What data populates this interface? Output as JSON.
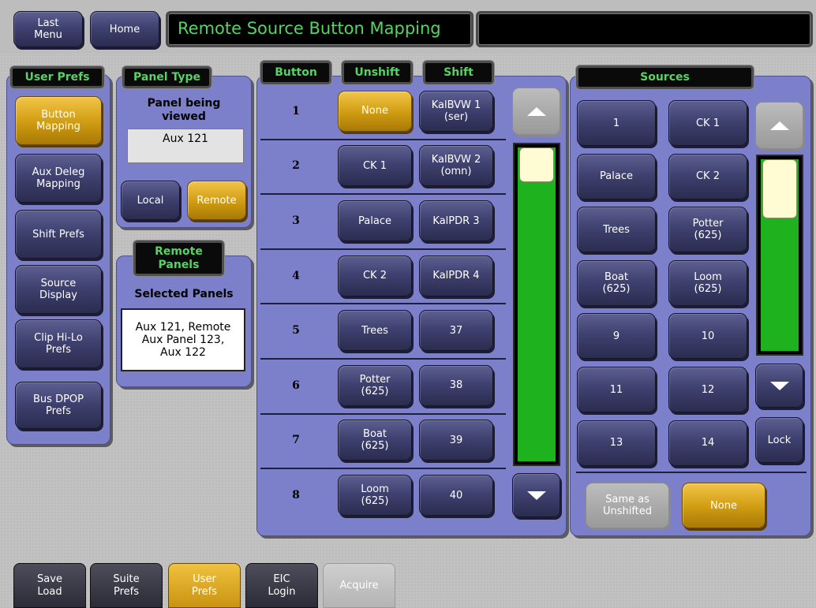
{
  "header": {
    "last_menu": "Last\nMenu",
    "home": "Home",
    "title": "Remote Source Button Mapping",
    "secondary_title": ""
  },
  "user_prefs": {
    "label": "User Prefs",
    "items": [
      {
        "label": "Button\nMapping",
        "selected": true
      },
      {
        "label": "Aux Deleg\nMapping",
        "selected": false
      },
      {
        "label": "Shift Prefs",
        "selected": false
      },
      {
        "label": "Source\nDisplay",
        "selected": false
      },
      {
        "label": "Clip Hi-Lo\nPrefs",
        "selected": false
      },
      {
        "label": "Bus DPOP\nPrefs",
        "selected": false
      }
    ]
  },
  "panel_type": {
    "label": "Panel Type",
    "heading": "Panel being\nviewed",
    "value": "Aux 121",
    "local": "Local",
    "remote": "Remote",
    "selected": "Remote"
  },
  "remote_panels": {
    "label": "Remote\nPanels",
    "heading": "Selected Panels",
    "value": "Aux 121, Remote\nAux Panel 123,\nAux 122"
  },
  "mapping": {
    "col_button": "Button",
    "col_unshift": "Unshift",
    "col_shift": "Shift",
    "rows": [
      {
        "num": "1",
        "unshift": "None",
        "shift": "KalBVW 1\n(ser)",
        "unshift_selected": true
      },
      {
        "num": "2",
        "unshift": "CK 1",
        "shift": "KalBVW 2\n(omn)",
        "unshift_selected": false
      },
      {
        "num": "3",
        "unshift": "Palace",
        "shift": "KalPDR 3",
        "unshift_selected": false
      },
      {
        "num": "4",
        "unshift": "CK 2",
        "shift": "KalPDR 4",
        "unshift_selected": false
      },
      {
        "num": "5",
        "unshift": "Trees",
        "shift": "37",
        "unshift_selected": false
      },
      {
        "num": "6",
        "unshift": "Potter\n(625)",
        "shift": "38",
        "unshift_selected": false
      },
      {
        "num": "7",
        "unshift": "Boat\n(625)",
        "shift": "39",
        "unshift_selected": false
      },
      {
        "num": "8",
        "unshift": "Loom\n(625)",
        "shift": "40",
        "unshift_selected": false
      }
    ],
    "scroll_position": 0.0
  },
  "sources": {
    "label": "Sources",
    "items": [
      "1",
      "CK 1",
      "Palace",
      "CK 2",
      "Trees",
      "Potter\n(625)",
      "Boat\n(625)",
      "Loom\n(625)",
      "9",
      "10",
      "11",
      "12",
      "13",
      "14"
    ],
    "lock": "Lock",
    "same_as_unshifted": "Same as\nUnshifted",
    "none": "None",
    "scroll_position": 0.0
  },
  "tabs": [
    {
      "label": "Save\nLoad",
      "style": "dark"
    },
    {
      "label": "Suite\nPrefs",
      "style": "dark"
    },
    {
      "label": "User\nPrefs",
      "style": "gold"
    },
    {
      "label": "EIC\nLogin",
      "style": "dark"
    },
    {
      "label": "Acquire",
      "style": "grey"
    }
  ],
  "colors": {
    "panel": "#7c7fc9",
    "selected": "#d39f14",
    "title_text": "#56d463",
    "scroll_fill": "#1fb21f"
  }
}
